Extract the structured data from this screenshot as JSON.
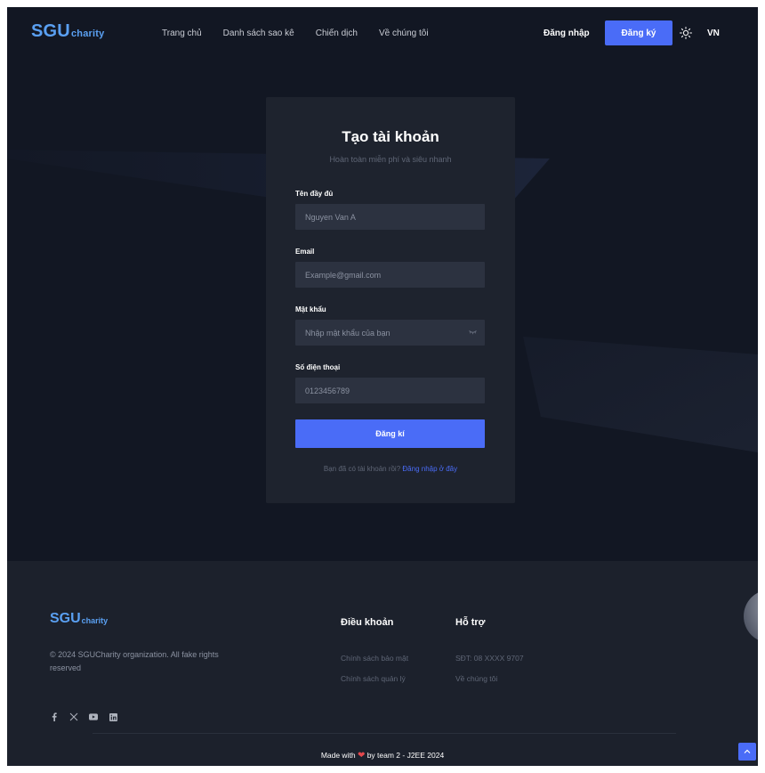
{
  "header": {
    "logo_main": "SGU",
    "logo_sub": "charity",
    "nav": [
      "Trang chủ",
      "Danh sách sao kê",
      "Chiến dịch",
      "Về chúng tôi"
    ],
    "login": "Đăng nhập",
    "register": "Đăng ký",
    "lang": "VN"
  },
  "form": {
    "title": "Tạo tài khoản",
    "subtitle": "Hoàn toàn miễn phí và siêu nhanh",
    "fullname_label": "Tên đầy đủ",
    "fullname_placeholder": "Nguyen Van A",
    "email_label": "Email",
    "email_placeholder": "Example@gmail.com",
    "password_label": "Mật khẩu",
    "password_placeholder": "Nhập mật khẩu của bạn",
    "phone_label": "Số điện thoại",
    "phone_placeholder": "0123456789",
    "submit": "Đăng kí",
    "have_account": "Bạn đã có tài khoản rồi?",
    "login_here": "Đăng nhập ở đây"
  },
  "footer": {
    "logo_main": "SGU",
    "logo_sub": "charity",
    "copyright": "© 2024 SGUCharity organization. All fake rights reserved",
    "terms_title": "Điều khoản",
    "terms_links": [
      "Chính sách bảo mật",
      "Chính sách quản lý"
    ],
    "support_title": "Hỗ trợ",
    "support_links": [
      "SĐT: 08 XXXX 9707",
      "Về chúng tôi"
    ],
    "made_with_prefix": "Made with",
    "made_with_suffix": "by team 2 - J2EE 2024"
  },
  "colors": {
    "accent": "#4a6cf7",
    "background": "#121723",
    "card": "#1e232e",
    "heart": "#e5484d"
  },
  "icons": [
    "sun-icon",
    "eye-icon",
    "facebook-icon",
    "x-icon",
    "youtube-icon",
    "linkedin-icon",
    "heart-icon",
    "arrow-up-icon"
  ]
}
